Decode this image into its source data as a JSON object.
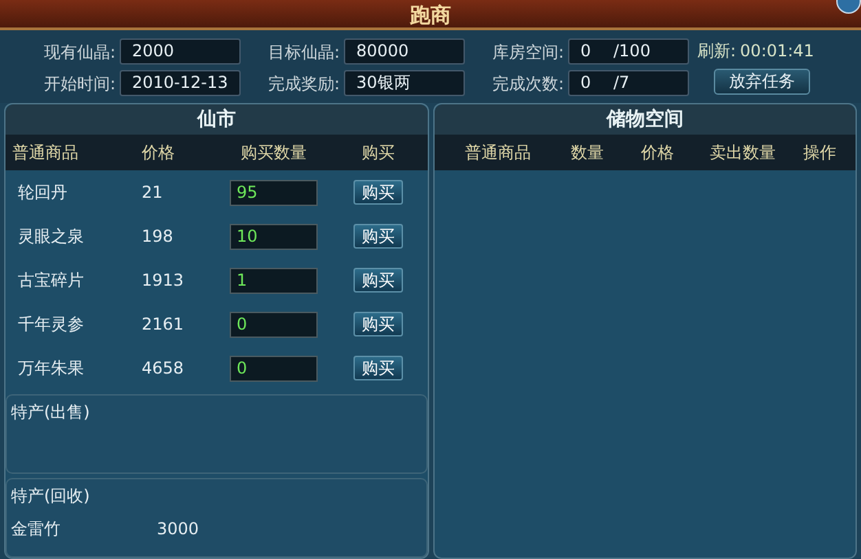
{
  "window": {
    "title": "跑商"
  },
  "info_rows": [
    [
      {
        "label": "现有仙晶:",
        "value": "2000"
      },
      {
        "label": "目标仙晶:",
        "value": "80000"
      },
      {
        "label": "库房空间:",
        "value": "0",
        "suffix": "/100"
      }
    ],
    [
      {
        "label": "开始时间:",
        "value": "2010-12-13"
      },
      {
        "label": "完成奖励:",
        "value": "30银两"
      },
      {
        "label": "完成次数:",
        "value": "0",
        "suffix": "/7"
      }
    ]
  ],
  "refresh": {
    "label": "刷新:",
    "value": "00:01:41"
  },
  "abandon_button": "放弃任务",
  "market": {
    "title": "仙市",
    "columns": [
      "普通商品",
      "价格",
      "购买数量",
      "购买"
    ],
    "rows": [
      {
        "name": "轮回丹",
        "price": "21",
        "quantity": "95",
        "button": "购买"
      },
      {
        "name": "灵眼之泉",
        "price": "198",
        "quantity": "10",
        "button": "购买"
      },
      {
        "name": "古宝碎片",
        "price": "1913",
        "quantity": "1",
        "button": "购买"
      },
      {
        "name": "千年灵参",
        "price": "2161",
        "quantity": "0",
        "button": "购买"
      },
      {
        "name": "万年朱果",
        "price": "4658",
        "quantity": "0",
        "button": "购买"
      }
    ]
  },
  "special_sell": {
    "title": "特产(出售)"
  },
  "special_buyback": {
    "title": "特产(回收)",
    "items": [
      {
        "name": "金雷竹",
        "price": "3000"
      }
    ]
  },
  "storage": {
    "title": "储物空间",
    "columns": [
      "普通商品",
      "数量",
      "价格",
      "卖出数量",
      "操作"
    ]
  }
}
